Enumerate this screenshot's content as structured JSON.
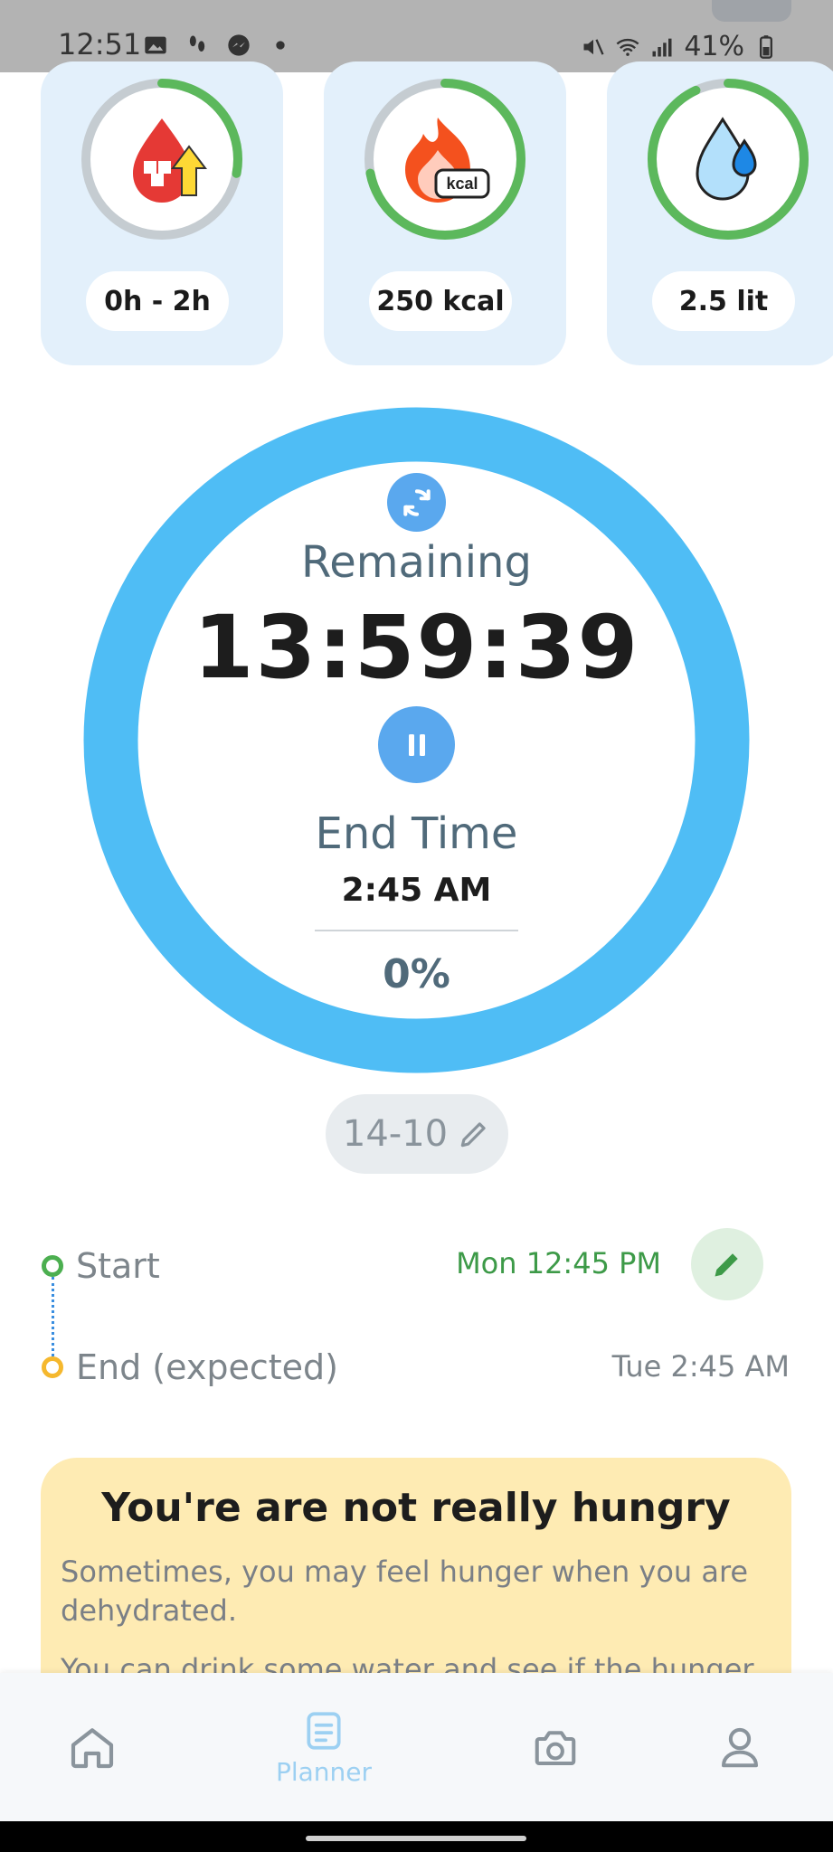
{
  "status_bar": {
    "time": "12:51",
    "battery": "41%",
    "left_icons": [
      "image-icon",
      "footprints-icon",
      "messenger-icon",
      "dot-icon"
    ],
    "right_icons": [
      "mute-icon",
      "wifi-icon",
      "signal-icon",
      "battery-icon"
    ]
  },
  "stats": [
    {
      "icon": "blood-sugar-icon",
      "label": "0h - 2h",
      "progress": 0.28,
      "color": "#5cb85c"
    },
    {
      "icon": "kcal-flame-icon",
      "label": "250 kcal",
      "progress": 0.72,
      "color": "#5cb85c"
    },
    {
      "icon": "water-drop-icon",
      "label": "2.5 lit",
      "progress": 0.93,
      "color": "#5cb85c"
    }
  ],
  "timer": {
    "remaining_label": "Remaining",
    "remaining_time": "13:59:39",
    "end_label": "End Time",
    "end_time": "2:45 AM",
    "percent": "0%",
    "ring_color": "#4fbdf5"
  },
  "plan": {
    "label": "14-10"
  },
  "timeline": {
    "start_label": "Start",
    "start_time": "Mon 12:45 PM",
    "end_label": "End (expected)",
    "end_time": "Tue 2:45 AM"
  },
  "tip": {
    "title": "You're are not really hungry",
    "paragraphs": [
      "Sometimes, you may feel hunger when you are dehydrated.",
      "You can drink some water and see if the hunger"
    ]
  },
  "nav": {
    "items": [
      {
        "icon": "home-icon",
        "label": ""
      },
      {
        "icon": "planner-icon",
        "label": "Planner"
      },
      {
        "icon": "camera-icon",
        "label": ""
      },
      {
        "icon": "profile-icon",
        "label": ""
      }
    ],
    "accent": "#9cd0f2"
  }
}
